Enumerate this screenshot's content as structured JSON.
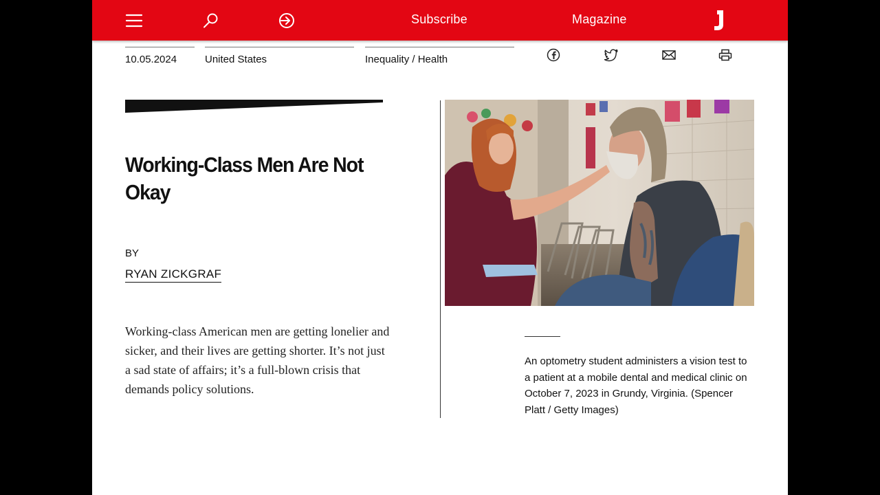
{
  "nav": {
    "subscribe": "Subscribe",
    "magazine": "Magazine",
    "logo": "J",
    "brand_color": "#e30613",
    "icons": [
      "menu-icon",
      "search-icon",
      "login-icon"
    ]
  },
  "meta": {
    "date": "10.05.2024",
    "location": "United States",
    "topics": "Inequality / Health"
  },
  "share_icons": [
    "facebook-icon",
    "twitter-icon",
    "email-icon",
    "print-icon"
  ],
  "article": {
    "title": "Working-Class Men Are Not Okay",
    "by_label": "BY",
    "author": "RYAN ZICKGRAF",
    "dek": "Working-class American men are getting lonelier and sicker, and their lives are getting shorter. It’s not just a sad state of affairs; it’s a full-blown crisis that demands policy solutions."
  },
  "photo": {
    "caption": "An optometry student administers a vision test to a patient at a mobile dental and medical clinic on October 7, 2023 in Grundy, Virginia. (Spencer Platt / Getty Images)"
  }
}
